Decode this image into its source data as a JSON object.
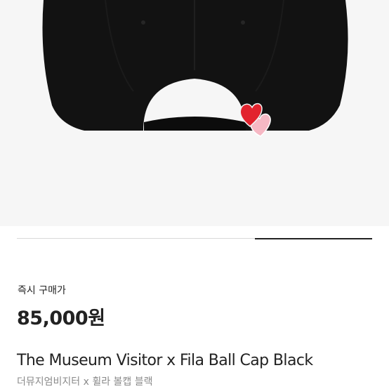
{
  "product": {
    "image_alt": "product-photo-black-ball-cap-back-view",
    "image_progress": 0.33,
    "price_label": "즉시 구매가",
    "price": "85,000원",
    "name_en": "The Museum Visitor x Fila Ball Cap Black",
    "name_ko": "더뮤지엄비지터 x 휠라 볼캡 블랙"
  },
  "colors": {
    "background": "#ffffff",
    "image_bg": "#f6f6f6",
    "text_primary": "#222222",
    "text_secondary": "#8a8a8a",
    "progress_track": "#d9d9d9",
    "progress_fill": "#222222",
    "heart_red": "#e2232e",
    "heart_pink": "#f6b8c4"
  }
}
